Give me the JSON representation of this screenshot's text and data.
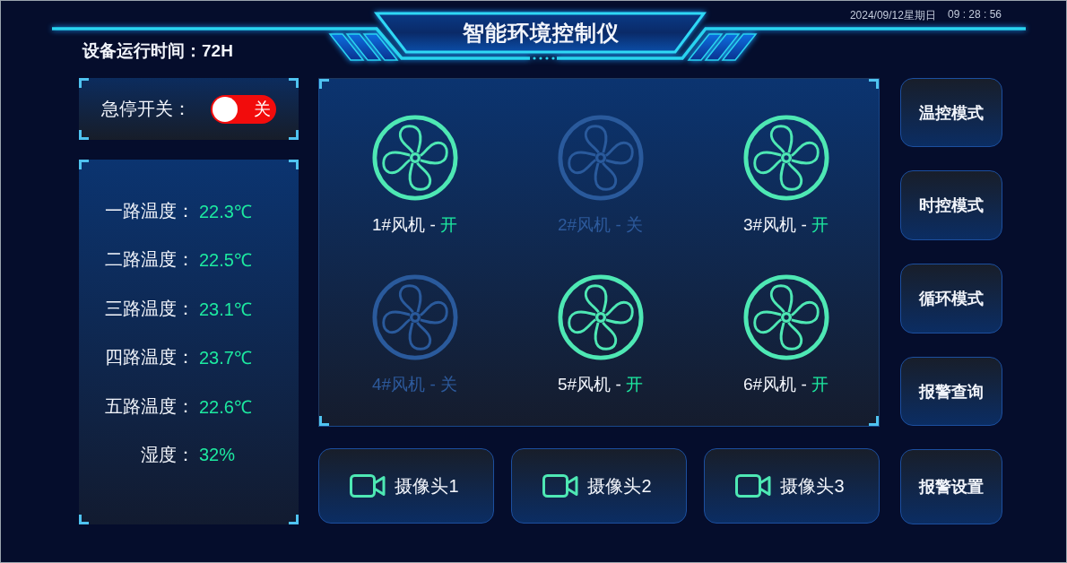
{
  "header": {
    "title": "智能环境控制仪",
    "date": "2024/09/12星期日",
    "time": "09 : 28 : 56",
    "runtime": "设备运行时间：72H"
  },
  "emergency_stop": {
    "label": "急停开关：",
    "on": false,
    "state_text": "关"
  },
  "sensors": [
    {
      "label": "一路温度：",
      "value": "22.3℃"
    },
    {
      "label": "二路温度：",
      "value": "22.5℃"
    },
    {
      "label": "三路温度：",
      "value": "23.1℃"
    },
    {
      "label": "四路温度：",
      "value": "23.7℃"
    },
    {
      "label": "五路温度：",
      "value": "22.6℃"
    },
    {
      "label": "湿度：",
      "value": "32%"
    }
  ],
  "fans": [
    {
      "name": "1#风机 -",
      "status": "开",
      "on": true
    },
    {
      "name": "2#风机 -",
      "status": "关",
      "on": false
    },
    {
      "name": "3#风机 -",
      "status": "开",
      "on": true
    },
    {
      "name": "4#风机 -",
      "status": "关",
      "on": false
    },
    {
      "name": "5#风机 -",
      "status": "开",
      "on": true
    },
    {
      "name": "6#风机 -",
      "status": "开",
      "on": true
    }
  ],
  "cameras": [
    {
      "label": "摄像头1"
    },
    {
      "label": "摄像头2"
    },
    {
      "label": "摄像头3"
    }
  ],
  "mode_buttons": [
    "温控模式",
    "时控模式",
    "循环模式",
    "报警查询",
    "报警设置"
  ]
}
